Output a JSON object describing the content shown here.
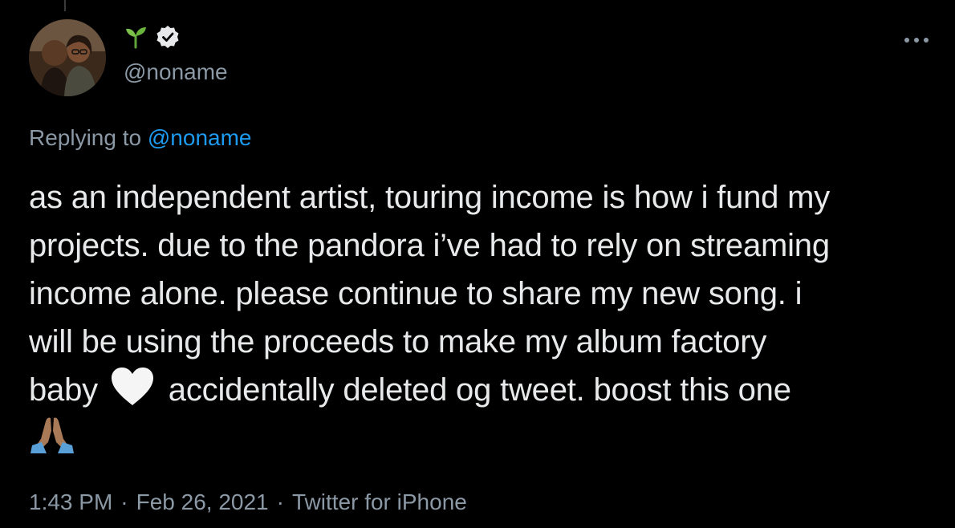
{
  "tweet": {
    "handle": "@noname",
    "replying_prefix": "Replying to",
    "replying_mention": "@noname",
    "text_lines": [
      "as an independent artist, touring income is how i fund my",
      "projects. due to the pandora i’ve had to rely on streaming",
      "income alone. please continue to share my new song. i",
      "will be using the proceeds to make my album factory"
    ],
    "text_line5_before": "baby",
    "text_line5_after": "accidentally deleted og tweet. boost this one",
    "time": "1:43 PM",
    "date": "Feb 26, 2021",
    "client": "Twitter for iPhone",
    "separator": "·"
  },
  "icons": {
    "name_emoji": "sprout-icon",
    "verified": "verified-badge-icon",
    "more": "more-options-icon",
    "heart": "white-heart-icon",
    "pray": "folded-hands-icon"
  },
  "colors": {
    "background": "#000000",
    "text": "#e7e9ea",
    "secondary": "#8b98a5",
    "link": "#1d9bf0"
  }
}
